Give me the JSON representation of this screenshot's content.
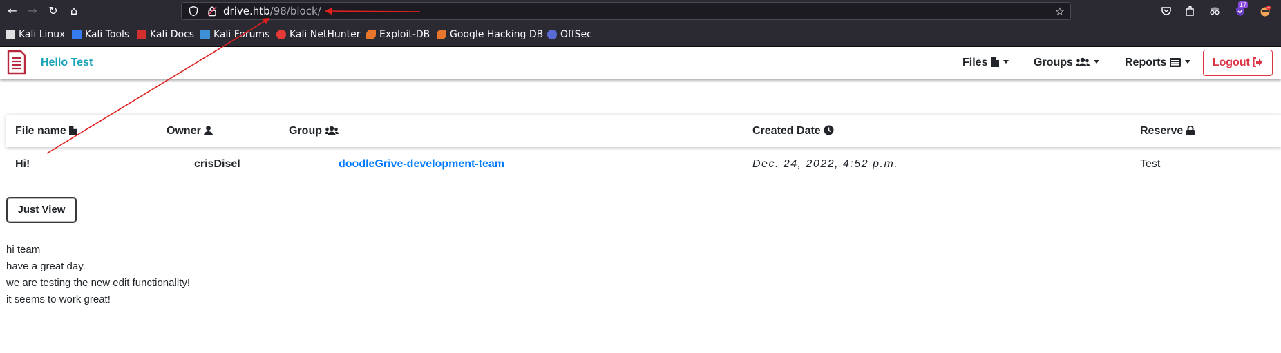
{
  "browser": {
    "url_host": "drive.htb",
    "url_path": "/98/block/",
    "notifications_badge": "17"
  },
  "bookmarks": [
    {
      "label": "Kali Linux",
      "icon": "kali-icon",
      "color": "#e0e0e0"
    },
    {
      "label": "Kali Tools",
      "icon": "kali-tools-icon",
      "color": "#367bf0"
    },
    {
      "label": "Kali Docs",
      "icon": "kali-docs-icon",
      "color": "#d32f2f"
    },
    {
      "label": "Kali Forums",
      "icon": "kali-forums-icon",
      "color": "#3d8fd6"
    },
    {
      "label": "Kali NetHunter",
      "icon": "nethunter-icon",
      "color": "#e53935"
    },
    {
      "label": "Exploit-DB",
      "icon": "exploitdb-icon",
      "color": "#e8762d"
    },
    {
      "label": "Google Hacking DB",
      "icon": "ghdb-icon",
      "color": "#e8762d"
    },
    {
      "label": "OffSec",
      "icon": "offsec-icon",
      "color": "#5a6bd6"
    }
  ],
  "site": {
    "brand": "Hello Test",
    "nav": {
      "files": "Files",
      "groups": "Groups",
      "reports": "Reports",
      "logout": "Logout"
    },
    "colors": {
      "brand": "#17a2b8",
      "logout": "#dc3545",
      "link": "#007bff",
      "logo": "#b8283c"
    }
  },
  "table": {
    "headers": [
      "File name",
      "Owner",
      "Group",
      "Created Date",
      "Reserve"
    ],
    "rows": [
      {
        "file_name": "Hi!",
        "owner": "crisDisel",
        "group": "doodleGrive-development-team",
        "created": "Dec. 24, 2022, 4:52 p.m.",
        "reserve": "Test"
      }
    ]
  },
  "just_view_label": "Just View",
  "content_lines": [
    "hi team",
    "have a great day.",
    "we are testing the new edit functionality!",
    "it seems to work great!"
  ]
}
